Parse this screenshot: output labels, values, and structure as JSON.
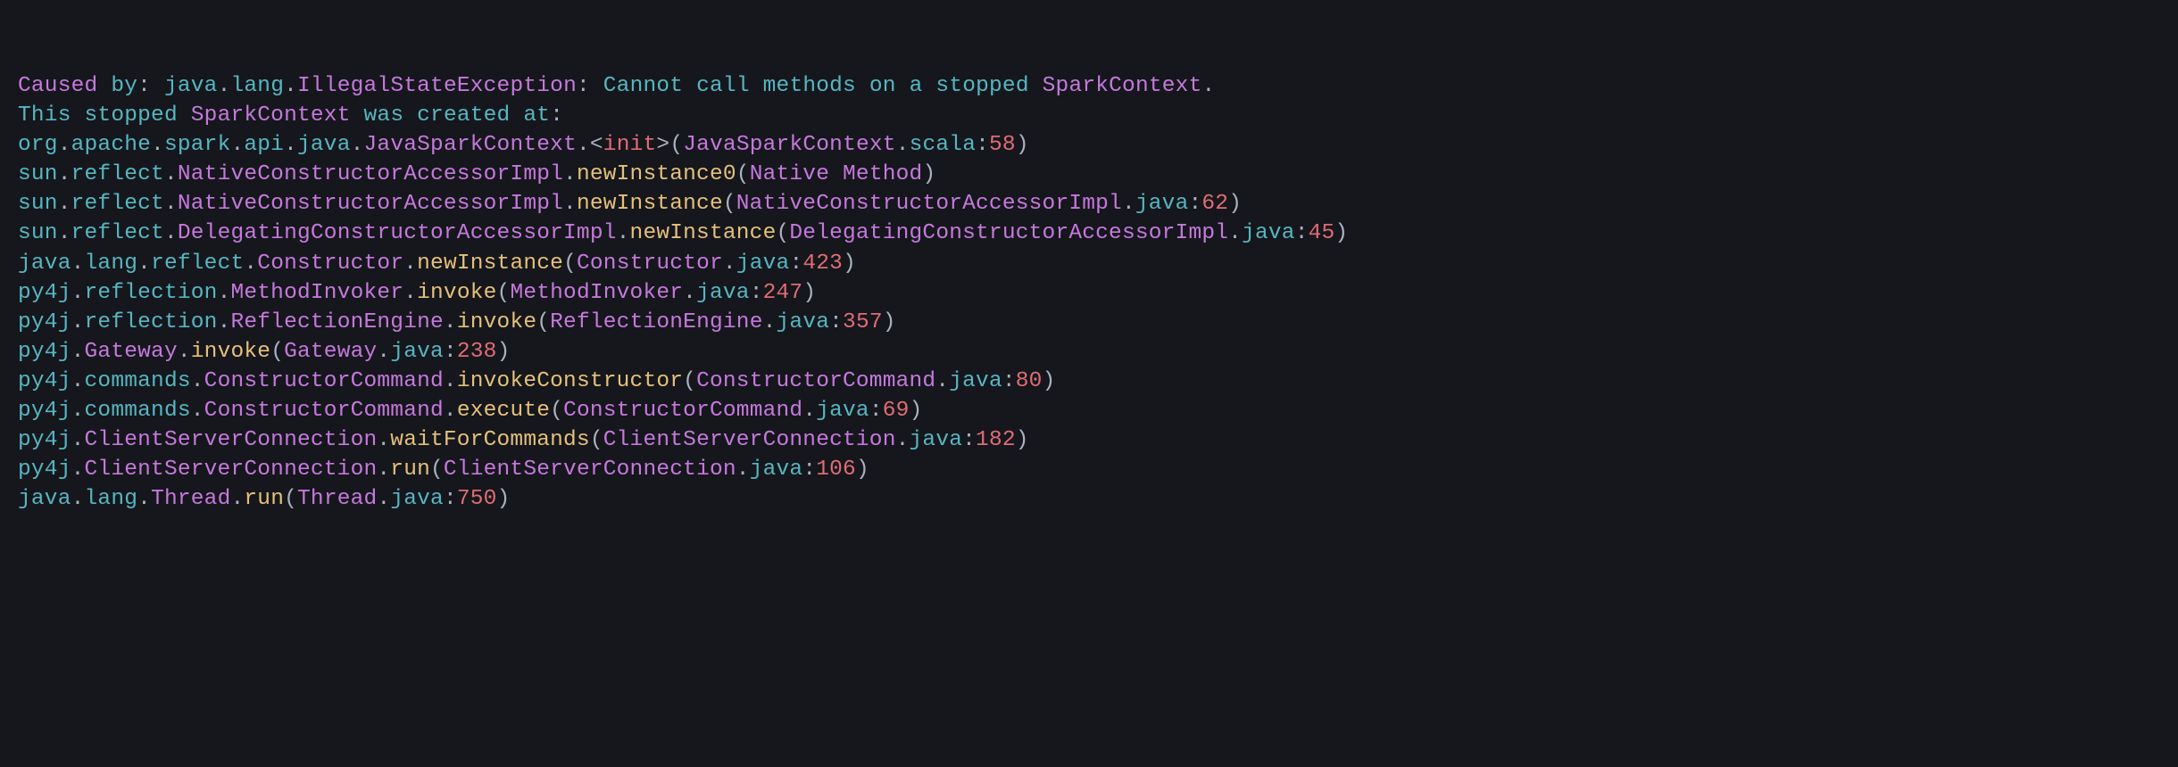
{
  "header": {
    "caused_by": "Caused",
    "by_word": "by",
    "exc_pkg": "java.lang",
    "exc_class": "IllegalStateException",
    "msg_words": [
      "Cannot",
      "call",
      "methods",
      "on",
      "a",
      "stopped"
    ],
    "msg_tail_class": "SparkContext",
    "line2_words": [
      "This",
      "stopped"
    ],
    "line2_class": "SparkContext",
    "line2_tail": [
      "was",
      "created",
      "at"
    ]
  },
  "frames": [
    {
      "pkg": "org.apache.spark.api.java",
      "cls": "JavaSparkContext",
      "method": "<init>",
      "file": "JavaSparkContext",
      "ext": "scala",
      "line": "58"
    },
    {
      "pkg": "sun.reflect",
      "cls": "NativeConstructorAccessorImpl",
      "method": "newInstance0",
      "native": "Native Method"
    },
    {
      "pkg": "sun.reflect",
      "cls": "NativeConstructorAccessorImpl",
      "method": "newInstance",
      "file": "NativeConstructorAccessorImpl",
      "ext": "java",
      "line": "62"
    },
    {
      "pkg": "sun.reflect",
      "cls": "DelegatingConstructorAccessorImpl",
      "method": "newInstance",
      "file": "DelegatingConstructorAccessorImpl",
      "ext": "java",
      "line": "45"
    },
    {
      "pkg": "java.lang.reflect",
      "cls": "Constructor",
      "method": "newInstance",
      "file": "Constructor",
      "ext": "java",
      "line": "423"
    },
    {
      "pkg": "py4j.reflection",
      "cls": "MethodInvoker",
      "method": "invoke",
      "file": "MethodInvoker",
      "ext": "java",
      "line": "247"
    },
    {
      "pkg": "py4j.reflection",
      "cls": "ReflectionEngine",
      "method": "invoke",
      "file": "ReflectionEngine",
      "ext": "java",
      "line": "357"
    },
    {
      "pkg": "py4j",
      "cls": "Gateway",
      "method": "invoke",
      "file": "Gateway",
      "ext": "java",
      "line": "238"
    },
    {
      "pkg": "py4j.commands",
      "cls": "ConstructorCommand",
      "method": "invokeConstructor",
      "file": "ConstructorCommand",
      "ext": "java",
      "line": "80"
    },
    {
      "pkg": "py4j.commands",
      "cls": "ConstructorCommand",
      "method": "execute",
      "file": "ConstructorCommand",
      "ext": "java",
      "line": "69"
    },
    {
      "pkg": "py4j",
      "cls": "ClientServerConnection",
      "method": "waitForCommands",
      "file": "ClientServerConnection",
      "ext": "java",
      "line": "182"
    },
    {
      "pkg": "py4j",
      "cls": "ClientServerConnection",
      "method": "run",
      "file": "ClientServerConnection",
      "ext": "java",
      "line": "106"
    },
    {
      "pkg": "java.lang",
      "cls": "Thread",
      "method": "run",
      "file": "Thread",
      "ext": "java",
      "line": "750"
    }
  ]
}
